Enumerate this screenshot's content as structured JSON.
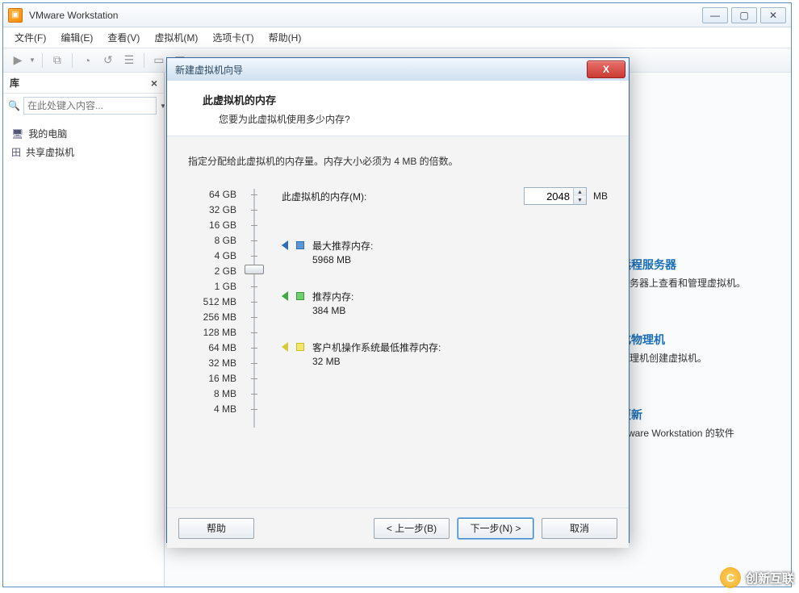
{
  "window": {
    "title": "VMware Workstation"
  },
  "menu": {
    "file": "文件(F)",
    "edit": "编辑(E)",
    "view": "查看(V)",
    "vm": "虚拟机(M)",
    "tabs": "选项卡(T)",
    "help": "帮助(H)"
  },
  "sidebar": {
    "title": "库",
    "search_placeholder": "在此处键入内容...",
    "items": [
      {
        "icon": "computer",
        "label": "我的电脑"
      },
      {
        "icon": "shared",
        "label": "共享虚拟机"
      }
    ]
  },
  "home_cards": [
    {
      "title": "远程服务器",
      "desc": "服务器上查看和管理虚拟机。"
    },
    {
      "title": "化物理机",
      "desc": "物理机创建虚拟机。"
    },
    {
      "title": "更新",
      "desc": "Mware Workstation 的软件"
    }
  ],
  "dialog": {
    "title": "新建虚拟机向导",
    "header": "此虚拟机的内存",
    "subheader": "您要为此虚拟机使用多少内存?",
    "desc": "指定分配给此虚拟机的内存量。内存大小必须为 4 MB 的倍数。",
    "mem_label": "此虚拟机的内存(M):",
    "mem_value": "2048",
    "mem_unit": "MB",
    "scale": [
      "64 GB",
      "32 GB",
      "16 GB",
      "8 GB",
      "4 GB",
      "2 GB",
      "1 GB",
      "512 MB",
      "256 MB",
      "128 MB",
      "64 MB",
      "32 MB",
      "16 MB",
      "8 MB",
      "4 MB"
    ],
    "rec_max_label": "最大推荐内存:",
    "rec_max_value": "5968 MB",
    "rec_label": "推荐内存:",
    "rec_value": "384 MB",
    "rec_min_label": "客户机操作系统最低推荐内存:",
    "rec_min_value": "32 MB",
    "btn_help": "帮助",
    "btn_back": "< 上一步(B)",
    "btn_next": "下一步(N) >",
    "btn_cancel": "取消"
  },
  "watermark": "创新互联"
}
